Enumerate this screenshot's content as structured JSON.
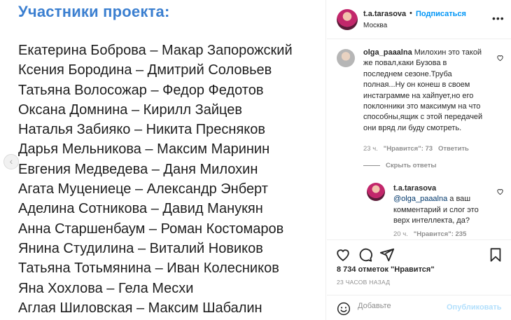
{
  "image": {
    "heading": "Участники проекта:",
    "pairs": [
      "Екатерина Боброва – Макар Запорожский",
      "Ксения Бородина – Дмитрий Соловьев",
      "Татьяна Волосожар – Федор Федотов",
      "Оксана Домнина – Кирилл Зайцев",
      "Наталья Забияко – Никита Пресняков",
      "Дарья Мельникова – Максим Маринин",
      "Евгения Медведева – Даня Милохин",
      "Агата Муцениеце – Александр Энберт",
      "Аделина Сотникова – Давид Манукян",
      "Анна Старшенбаум – Роман Костомаров",
      "Янина Студилина – Виталий Новиков",
      "Татьяна Тотьмянина – Иван Колесников",
      "Яна Хохлова – Гела Месхи",
      "Аглая Шиловская – Максим Шабалин"
    ],
    "prev_icon": "chevron-left-icon",
    "prev_glyph": "‹"
  },
  "header": {
    "username": "t.a.tarasova",
    "separator": "•",
    "follow_label": "Подписаться",
    "location": "Москва",
    "more_glyph": "•••"
  },
  "comments": [
    {
      "username": "olga_paaalna",
      "text": "Милохин это такой же повал,каки Бузова в последнем сезоне.Труба полная...Ну он конеш в своем инстаграмме на хайпует,но его поклонники это максимум на что способны,ящик с этой передачей они вряд ли буду смотреть.",
      "time": "23 ч.",
      "likes": "\"Нравится\": 73",
      "reply_label": "Ответить",
      "hide_replies_label": "Скрыть ответы"
    },
    {
      "username": "t.a.tarasova",
      "mention": "@olga_paaalna",
      "text": " а ваш комментарий и слог это верх интеллекта, да?",
      "time": "20 ч.",
      "likes": "\"Нравится\": 235"
    }
  ],
  "actions": {
    "likes_count": "8 734 отметок \"Нравится\"",
    "time_ago": "23 ЧАСОВ НАЗАД"
  },
  "comment_box": {
    "placeholder": "Добавьте",
    "publish_label": "Опубликовать"
  },
  "colors": {
    "heading_blue": "#3b7fd0",
    "link_blue": "#0095f6",
    "publish_disabled": "#b2dffc"
  }
}
